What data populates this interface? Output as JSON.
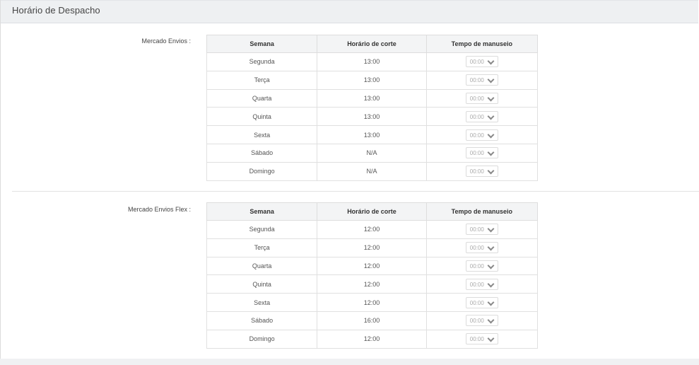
{
  "panel": {
    "title": "Horário de Despacho"
  },
  "columns": {
    "week": "Semana",
    "cutoff": "Horário de corte",
    "handling": "Tempo de manuseio"
  },
  "sections": [
    {
      "label": "Mercado Envios :",
      "rows": [
        {
          "day": "Segunda",
          "cutoff": "13:00",
          "handling": "00:00"
        },
        {
          "day": "Terça",
          "cutoff": "13:00",
          "handling": "00:00"
        },
        {
          "day": "Quarta",
          "cutoff": "13:00",
          "handling": "00:00"
        },
        {
          "day": "Quinta",
          "cutoff": "13:00",
          "handling": "00:00"
        },
        {
          "day": "Sexta",
          "cutoff": "13:00",
          "handling": "00:00"
        },
        {
          "day": "Sábado",
          "cutoff": "N/A",
          "handling": "00:00"
        },
        {
          "day": "Domingo",
          "cutoff": "N/A",
          "handling": "00:00"
        }
      ]
    },
    {
      "label": "Mercado Envios Flex :",
      "rows": [
        {
          "day": "Segunda",
          "cutoff": "12:00",
          "handling": "00:00"
        },
        {
          "day": "Terça",
          "cutoff": "12:00",
          "handling": "00:00"
        },
        {
          "day": "Quarta",
          "cutoff": "12:00",
          "handling": "00:00"
        },
        {
          "day": "Quinta",
          "cutoff": "12:00",
          "handling": "00:00"
        },
        {
          "day": "Sexta",
          "cutoff": "12:00",
          "handling": "00:00"
        },
        {
          "day": "Sábado",
          "cutoff": "16:00",
          "handling": "00:00"
        },
        {
          "day": "Domingo",
          "cutoff": "12:00",
          "handling": "00:00"
        }
      ]
    }
  ]
}
